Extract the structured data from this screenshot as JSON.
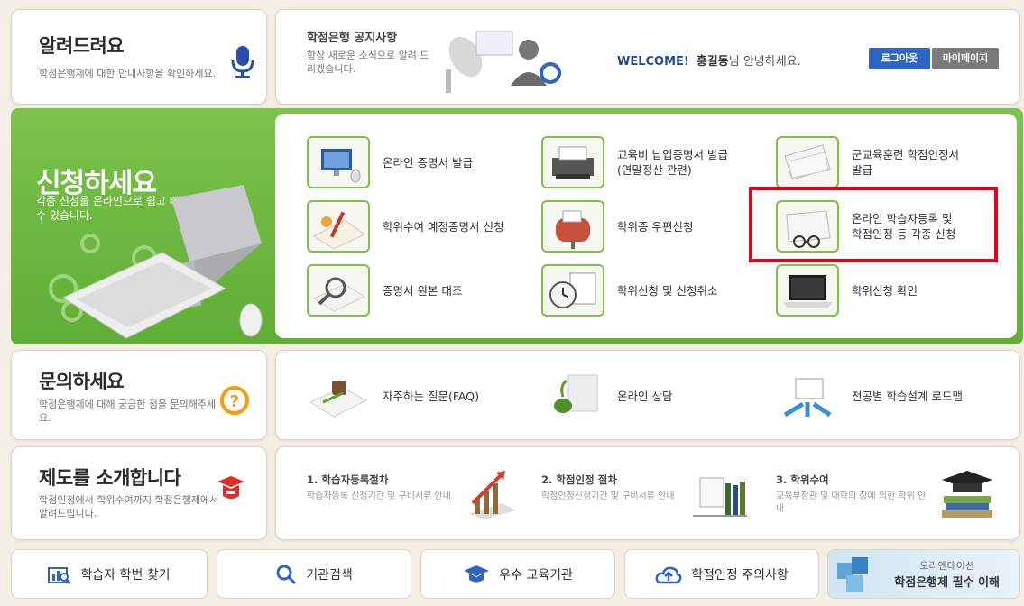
{
  "notice": {
    "title": "알려드려요",
    "desc": "학점은행제에 대한 안내사항을 확인하세요."
  },
  "news": {
    "title": "학점은행 공지사항",
    "desc": "항상 새로운 소식으로 알려 드리겠습니다.",
    "welcome_label": "WELCOME!",
    "user_name": "홍길동",
    "greeting": "님 안녕하세요.",
    "logout_label": "로그아웃",
    "mypage_label": "마이페이지"
  },
  "apply": {
    "title": "신청하세요",
    "desc": "각종 신청을 온라인으로 쉽고 빠르게 할 수 있습니다.",
    "items": [
      {
        "label": "온라인 증명서 발급"
      },
      {
        "label": "교육비 납입증명서 발급\n(연말정산 관련)"
      },
      {
        "label": "군교육훈련 학점인정서\n발급"
      },
      {
        "label": "학위수여 예정증명서 신청"
      },
      {
        "label": "학위증 우편신청"
      },
      {
        "label": "온라인 학습자등록 및\n학점인정 등 각종 신청"
      },
      {
        "label": "증명서 원본 대조"
      },
      {
        "label": "학위신청 및 신청취소"
      },
      {
        "label": "학위신청 확인"
      }
    ]
  },
  "inquiry": {
    "title": "문의하세요",
    "desc": "학점은행제에 대해 궁금한 점을 문의해주세요.",
    "items": [
      {
        "label": "자주하는 질문(FAQ)"
      },
      {
        "label": "온라인 상담"
      },
      {
        "label": "전공별 학습설계 로드맵"
      }
    ]
  },
  "intro": {
    "title": "제도를 소개합니다",
    "desc": "학점인정에서 학위수여까지 학점은행제에서 알려드립니다.",
    "steps": [
      {
        "title": "1. 학습자등록절차",
        "desc": "학습자등록 신청기간 및 구비서류 안내"
      },
      {
        "title": "2. 학점인정 절차",
        "desc": "학점인정신청기간 및 구비서류 안내"
      },
      {
        "title": "3. 학위수여",
        "desc": "교육부장관 및 대학의 장에 의한 학위 안내"
      }
    ]
  },
  "bottom": {
    "student_id": "학습자 학번 찾기",
    "institution_search": "기관검색",
    "excellent": "우수 교육기관",
    "caution": "학점인정 주의사항",
    "orientation_sub": "오리엔테이션",
    "orientation_main": "학점은행제 필수 이해"
  },
  "colors": {
    "green": "#6bb83f",
    "blue_button": "#2f63c6",
    "highlight": "#e60012"
  }
}
